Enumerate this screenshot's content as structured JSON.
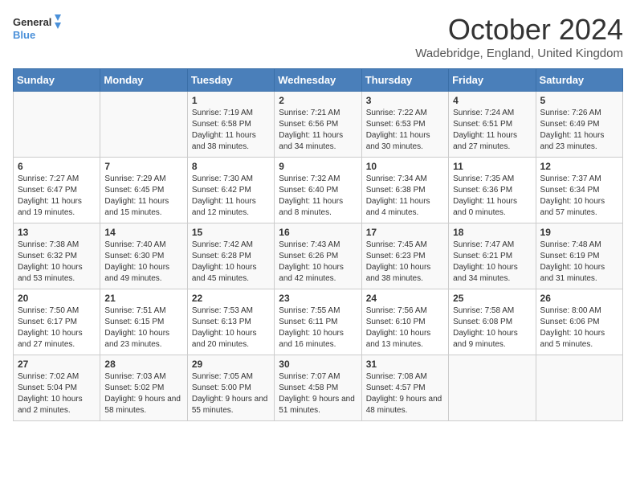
{
  "header": {
    "logo_line1": "General",
    "logo_line2": "Blue",
    "month": "October 2024",
    "location": "Wadebridge, England, United Kingdom"
  },
  "weekdays": [
    "Sunday",
    "Monday",
    "Tuesday",
    "Wednesday",
    "Thursday",
    "Friday",
    "Saturday"
  ],
  "weeks": [
    [
      {
        "day": "",
        "sunrise": "",
        "sunset": "",
        "daylight": ""
      },
      {
        "day": "",
        "sunrise": "",
        "sunset": "",
        "daylight": ""
      },
      {
        "day": "1",
        "sunrise": "Sunrise: 7:19 AM",
        "sunset": "Sunset: 6:58 PM",
        "daylight": "Daylight: 11 hours and 38 minutes."
      },
      {
        "day": "2",
        "sunrise": "Sunrise: 7:21 AM",
        "sunset": "Sunset: 6:56 PM",
        "daylight": "Daylight: 11 hours and 34 minutes."
      },
      {
        "day": "3",
        "sunrise": "Sunrise: 7:22 AM",
        "sunset": "Sunset: 6:53 PM",
        "daylight": "Daylight: 11 hours and 30 minutes."
      },
      {
        "day": "4",
        "sunrise": "Sunrise: 7:24 AM",
        "sunset": "Sunset: 6:51 PM",
        "daylight": "Daylight: 11 hours and 27 minutes."
      },
      {
        "day": "5",
        "sunrise": "Sunrise: 7:26 AM",
        "sunset": "Sunset: 6:49 PM",
        "daylight": "Daylight: 11 hours and 23 minutes."
      }
    ],
    [
      {
        "day": "6",
        "sunrise": "Sunrise: 7:27 AM",
        "sunset": "Sunset: 6:47 PM",
        "daylight": "Daylight: 11 hours and 19 minutes."
      },
      {
        "day": "7",
        "sunrise": "Sunrise: 7:29 AM",
        "sunset": "Sunset: 6:45 PM",
        "daylight": "Daylight: 11 hours and 15 minutes."
      },
      {
        "day": "8",
        "sunrise": "Sunrise: 7:30 AM",
        "sunset": "Sunset: 6:42 PM",
        "daylight": "Daylight: 11 hours and 12 minutes."
      },
      {
        "day": "9",
        "sunrise": "Sunrise: 7:32 AM",
        "sunset": "Sunset: 6:40 PM",
        "daylight": "Daylight: 11 hours and 8 minutes."
      },
      {
        "day": "10",
        "sunrise": "Sunrise: 7:34 AM",
        "sunset": "Sunset: 6:38 PM",
        "daylight": "Daylight: 11 hours and 4 minutes."
      },
      {
        "day": "11",
        "sunrise": "Sunrise: 7:35 AM",
        "sunset": "Sunset: 6:36 PM",
        "daylight": "Daylight: 11 hours and 0 minutes."
      },
      {
        "day": "12",
        "sunrise": "Sunrise: 7:37 AM",
        "sunset": "Sunset: 6:34 PM",
        "daylight": "Daylight: 10 hours and 57 minutes."
      }
    ],
    [
      {
        "day": "13",
        "sunrise": "Sunrise: 7:38 AM",
        "sunset": "Sunset: 6:32 PM",
        "daylight": "Daylight: 10 hours and 53 minutes."
      },
      {
        "day": "14",
        "sunrise": "Sunrise: 7:40 AM",
        "sunset": "Sunset: 6:30 PM",
        "daylight": "Daylight: 10 hours and 49 minutes."
      },
      {
        "day": "15",
        "sunrise": "Sunrise: 7:42 AM",
        "sunset": "Sunset: 6:28 PM",
        "daylight": "Daylight: 10 hours and 45 minutes."
      },
      {
        "day": "16",
        "sunrise": "Sunrise: 7:43 AM",
        "sunset": "Sunset: 6:26 PM",
        "daylight": "Daylight: 10 hours and 42 minutes."
      },
      {
        "day": "17",
        "sunrise": "Sunrise: 7:45 AM",
        "sunset": "Sunset: 6:23 PM",
        "daylight": "Daylight: 10 hours and 38 minutes."
      },
      {
        "day": "18",
        "sunrise": "Sunrise: 7:47 AM",
        "sunset": "Sunset: 6:21 PM",
        "daylight": "Daylight: 10 hours and 34 minutes."
      },
      {
        "day": "19",
        "sunrise": "Sunrise: 7:48 AM",
        "sunset": "Sunset: 6:19 PM",
        "daylight": "Daylight: 10 hours and 31 minutes."
      }
    ],
    [
      {
        "day": "20",
        "sunrise": "Sunrise: 7:50 AM",
        "sunset": "Sunset: 6:17 PM",
        "daylight": "Daylight: 10 hours and 27 minutes."
      },
      {
        "day": "21",
        "sunrise": "Sunrise: 7:51 AM",
        "sunset": "Sunset: 6:15 PM",
        "daylight": "Daylight: 10 hours and 23 minutes."
      },
      {
        "day": "22",
        "sunrise": "Sunrise: 7:53 AM",
        "sunset": "Sunset: 6:13 PM",
        "daylight": "Daylight: 10 hours and 20 minutes."
      },
      {
        "day": "23",
        "sunrise": "Sunrise: 7:55 AM",
        "sunset": "Sunset: 6:11 PM",
        "daylight": "Daylight: 10 hours and 16 minutes."
      },
      {
        "day": "24",
        "sunrise": "Sunrise: 7:56 AM",
        "sunset": "Sunset: 6:10 PM",
        "daylight": "Daylight: 10 hours and 13 minutes."
      },
      {
        "day": "25",
        "sunrise": "Sunrise: 7:58 AM",
        "sunset": "Sunset: 6:08 PM",
        "daylight": "Daylight: 10 hours and 9 minutes."
      },
      {
        "day": "26",
        "sunrise": "Sunrise: 8:00 AM",
        "sunset": "Sunset: 6:06 PM",
        "daylight": "Daylight: 10 hours and 5 minutes."
      }
    ],
    [
      {
        "day": "27",
        "sunrise": "Sunrise: 7:02 AM",
        "sunset": "Sunset: 5:04 PM",
        "daylight": "Daylight: 10 hours and 2 minutes."
      },
      {
        "day": "28",
        "sunrise": "Sunrise: 7:03 AM",
        "sunset": "Sunset: 5:02 PM",
        "daylight": "Daylight: 9 hours and 58 minutes."
      },
      {
        "day": "29",
        "sunrise": "Sunrise: 7:05 AM",
        "sunset": "Sunset: 5:00 PM",
        "daylight": "Daylight: 9 hours and 55 minutes."
      },
      {
        "day": "30",
        "sunrise": "Sunrise: 7:07 AM",
        "sunset": "Sunset: 4:58 PM",
        "daylight": "Daylight: 9 hours and 51 minutes."
      },
      {
        "day": "31",
        "sunrise": "Sunrise: 7:08 AM",
        "sunset": "Sunset: 4:57 PM",
        "daylight": "Daylight: 9 hours and 48 minutes."
      },
      {
        "day": "",
        "sunrise": "",
        "sunset": "",
        "daylight": ""
      },
      {
        "day": "",
        "sunrise": "",
        "sunset": "",
        "daylight": ""
      }
    ]
  ]
}
